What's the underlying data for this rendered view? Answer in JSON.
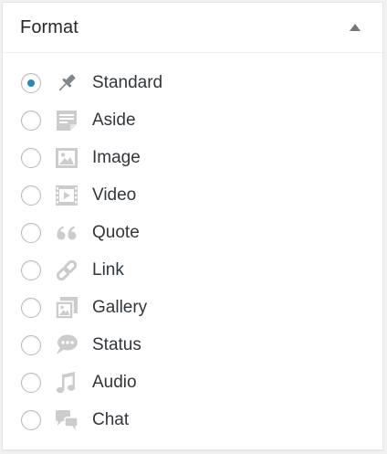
{
  "box": {
    "title": "Format",
    "toggle_icon": "arrow-up-icon"
  },
  "colors": {
    "icon_gray": "#cccccc",
    "checked_dot": "#1e8cbe",
    "text": "#32373c"
  },
  "formats": [
    {
      "label": "Standard",
      "icon": "pin-icon",
      "checked": true
    },
    {
      "label": "Aside",
      "icon": "aside-icon",
      "checked": false
    },
    {
      "label": "Image",
      "icon": "image-icon",
      "checked": false
    },
    {
      "label": "Video",
      "icon": "video-icon",
      "checked": false
    },
    {
      "label": "Quote",
      "icon": "quote-icon",
      "checked": false
    },
    {
      "label": "Link",
      "icon": "link-icon",
      "checked": false
    },
    {
      "label": "Gallery",
      "icon": "gallery-icon",
      "checked": false
    },
    {
      "label": "Status",
      "icon": "status-icon",
      "checked": false
    },
    {
      "label": "Audio",
      "icon": "audio-icon",
      "checked": false
    },
    {
      "label": "Chat",
      "icon": "chat-icon",
      "checked": false
    }
  ]
}
